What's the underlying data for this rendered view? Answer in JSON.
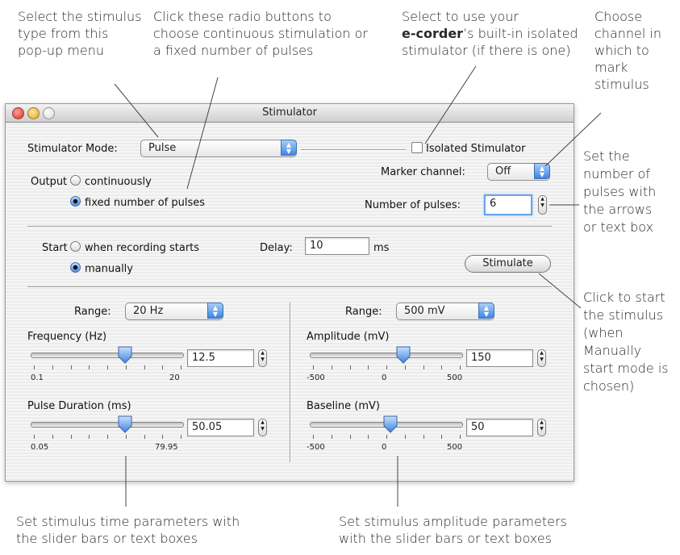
{
  "annotations": {
    "stimulus_type": [
      "Select the stimulus",
      "type from this",
      "pop-up menu"
    ],
    "radio_help": [
      "Click these radio buttons to",
      "choose continuous stimulation or",
      "a fixed number of pulses"
    ],
    "isolated_help": {
      "line1": "Select to use your",
      "brand": "e-corder",
      "line2_rest": "’s built-in isolated",
      "line3": "stimulator (if there is one)"
    },
    "marker_help": [
      "Choose",
      "channel in",
      "which to",
      "mark",
      "stimulus"
    ],
    "pulses_help": [
      "Set the",
      "number of",
      "pulses with",
      "the arrows",
      "or text box"
    ],
    "stimulate_help": [
      "Click to start",
      "the stimulus",
      "(when",
      "Manually",
      "start mode is",
      "chosen)"
    ],
    "time_help": [
      "Set stimulus time parameters with",
      "the slider bars or text boxes"
    ],
    "amp_help": [
      "Set stimulus amplitude parameters",
      "with the slider bars or text boxes"
    ]
  },
  "window": {
    "title": "Stimulator",
    "mode_label": "Stimulator Mode:",
    "mode_value": "Pulse",
    "isolated_label": "Isolated Stimulator",
    "isolated_checked": false,
    "output_label": "Output",
    "output_options": [
      "continuously",
      "fixed number of pulses"
    ],
    "output_selected": "fixed number of pulses",
    "marker_label": "Marker channel:",
    "marker_value": "Off",
    "pulses_label": "Number of pulses:",
    "pulses_value": "6",
    "start_label": "Start",
    "start_options": [
      "when recording starts",
      "manually"
    ],
    "start_selected": "manually",
    "delay_label": "Delay:",
    "delay_value": "10",
    "delay_unit": "ms",
    "stimulate_label": "Stimulate",
    "left": {
      "range_label": "Range:",
      "range_value": "20 Hz",
      "freq_label": "Frequency (Hz)",
      "freq_value": "12.5",
      "freq_min": "0.1",
      "freq_max": "20",
      "freq_fraction": 0.63,
      "dur_label": "Pulse Duration (ms)",
      "dur_value": "50.05",
      "dur_min": "0.05",
      "dur_max": "79.95",
      "dur_fraction": 0.63
    },
    "right": {
      "range_label": "Range:",
      "range_value": "500 mV",
      "amp_label": "Amplitude (mV)",
      "amp_value": "150",
      "amp_ticks": [
        "-500",
        "0",
        "500"
      ],
      "amp_fraction": 0.62,
      "base_label": "Baseline (mV)",
      "base_value": "50",
      "base_ticks": [
        "-500",
        "0",
        "500"
      ],
      "base_fraction": 0.53
    }
  }
}
